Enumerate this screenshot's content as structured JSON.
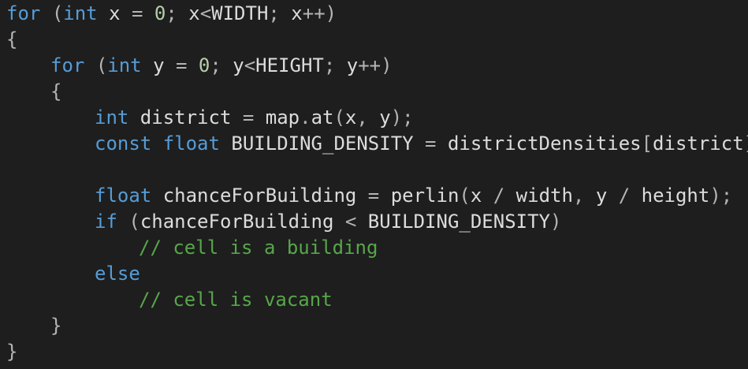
{
  "editor": {
    "colors": {
      "background": "#1e1e1e",
      "keyword": "#569cd6",
      "identifier": "#dcdcdc",
      "number": "#b5cea8",
      "operator": "#b4b4b4",
      "comment": "#57a64a"
    },
    "lines": [
      {
        "indent": 0,
        "tokens": [
          {
            "t": "kw",
            "v": "for"
          },
          {
            "t": "txt",
            "v": " "
          },
          {
            "t": "op",
            "v": "("
          },
          {
            "t": "kw",
            "v": "int"
          },
          {
            "t": "txt",
            "v": " x "
          },
          {
            "t": "op",
            "v": "="
          },
          {
            "t": "txt",
            "v": " "
          },
          {
            "t": "num",
            "v": "0"
          },
          {
            "t": "op",
            "v": ";"
          },
          {
            "t": "txt",
            "v": " x"
          },
          {
            "t": "op",
            "v": "<"
          },
          {
            "t": "txt",
            "v": "WIDTH"
          },
          {
            "t": "op",
            "v": ";"
          },
          {
            "t": "txt",
            "v": " x"
          },
          {
            "t": "op",
            "v": "++)"
          }
        ]
      },
      {
        "indent": 0,
        "tokens": [
          {
            "t": "op",
            "v": "{"
          }
        ]
      },
      {
        "indent": 1,
        "tokens": [
          {
            "t": "kw",
            "v": "for"
          },
          {
            "t": "txt",
            "v": " "
          },
          {
            "t": "op",
            "v": "("
          },
          {
            "t": "kw",
            "v": "int"
          },
          {
            "t": "txt",
            "v": " y "
          },
          {
            "t": "op",
            "v": "="
          },
          {
            "t": "txt",
            "v": " "
          },
          {
            "t": "num",
            "v": "0"
          },
          {
            "t": "op",
            "v": ";"
          },
          {
            "t": "txt",
            "v": " y"
          },
          {
            "t": "op",
            "v": "<"
          },
          {
            "t": "txt",
            "v": "HEIGHT"
          },
          {
            "t": "op",
            "v": ";"
          },
          {
            "t": "txt",
            "v": " y"
          },
          {
            "t": "op",
            "v": "++)"
          }
        ]
      },
      {
        "indent": 1,
        "tokens": [
          {
            "t": "op",
            "v": "{"
          }
        ]
      },
      {
        "indent": 2,
        "tokens": [
          {
            "t": "kw",
            "v": "int"
          },
          {
            "t": "txt",
            "v": " district "
          },
          {
            "t": "op",
            "v": "="
          },
          {
            "t": "txt",
            "v": " map"
          },
          {
            "t": "op",
            "v": "."
          },
          {
            "t": "txt",
            "v": "at"
          },
          {
            "t": "op",
            "v": "("
          },
          {
            "t": "txt",
            "v": "x"
          },
          {
            "t": "op",
            "v": ","
          },
          {
            "t": "txt",
            "v": " y"
          },
          {
            "t": "op",
            "v": ");"
          }
        ]
      },
      {
        "indent": 2,
        "tokens": [
          {
            "t": "kw",
            "v": "const"
          },
          {
            "t": "txt",
            "v": " "
          },
          {
            "t": "kw",
            "v": "float"
          },
          {
            "t": "txt",
            "v": " BUILDING_DENSITY "
          },
          {
            "t": "op",
            "v": "="
          },
          {
            "t": "txt",
            "v": " districtDensities"
          },
          {
            "t": "op",
            "v": "["
          },
          {
            "t": "txt",
            "v": "district"
          },
          {
            "t": "op",
            "v": "];"
          }
        ]
      },
      {
        "indent": 0,
        "tokens": []
      },
      {
        "indent": 2,
        "tokens": [
          {
            "t": "kw",
            "v": "float"
          },
          {
            "t": "txt",
            "v": " chanceForBuilding "
          },
          {
            "t": "op",
            "v": "="
          },
          {
            "t": "txt",
            "v": " perlin"
          },
          {
            "t": "op",
            "v": "("
          },
          {
            "t": "txt",
            "v": "x "
          },
          {
            "t": "op",
            "v": "/"
          },
          {
            "t": "txt",
            "v": " width"
          },
          {
            "t": "op",
            "v": ","
          },
          {
            "t": "txt",
            "v": " y "
          },
          {
            "t": "op",
            "v": "/"
          },
          {
            "t": "txt",
            "v": " height"
          },
          {
            "t": "op",
            "v": ");"
          }
        ]
      },
      {
        "indent": 2,
        "tokens": [
          {
            "t": "kw",
            "v": "if"
          },
          {
            "t": "txt",
            "v": " "
          },
          {
            "t": "op",
            "v": "("
          },
          {
            "t": "txt",
            "v": "chanceForBuilding "
          },
          {
            "t": "op",
            "v": "<"
          },
          {
            "t": "txt",
            "v": " BUILDING_DENSITY"
          },
          {
            "t": "op",
            "v": ")"
          }
        ]
      },
      {
        "indent": 3,
        "tokens": [
          {
            "t": "cmt",
            "v": "// cell is a building"
          }
        ]
      },
      {
        "indent": 2,
        "tokens": [
          {
            "t": "kw",
            "v": "else"
          }
        ]
      },
      {
        "indent": 3,
        "tokens": [
          {
            "t": "cmt",
            "v": "// cell is vacant"
          }
        ]
      },
      {
        "indent": 1,
        "tokens": [
          {
            "t": "op",
            "v": "}"
          }
        ]
      },
      {
        "indent": 0,
        "tokens": [
          {
            "t": "op",
            "v": "}"
          }
        ]
      }
    ]
  }
}
